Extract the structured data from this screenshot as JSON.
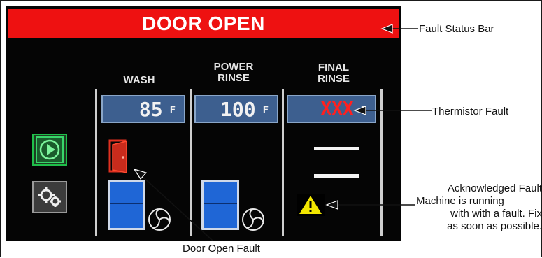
{
  "status_bar": {
    "text": "DOOR OPEN",
    "color": "#ee1111"
  },
  "columns": [
    {
      "header_line1": "",
      "header_line2": "WASH",
      "temp_value": "85",
      "temp_unit": "F",
      "fault": false
    },
    {
      "header_line1": "POWER",
      "header_line2": "RINSE",
      "temp_value": "100",
      "temp_unit": "F",
      "fault": false
    },
    {
      "header_line1": "FINAL",
      "header_line2": "RINSE",
      "temp_value": "XXX",
      "temp_unit": "F",
      "fault": true
    }
  ],
  "icons": {
    "start": "play-button-icon",
    "settings": "gears-icon",
    "door": "door-open-icon",
    "tank": "tank-icon",
    "fan": "fan-icon",
    "warning": "warning-triangle-icon"
  },
  "annotations": {
    "fault_status_bar": "Fault Status Bar",
    "thermistor_fault": "Thermistor Fault",
    "acknowledged_fault_lines": [
      "Acknowledged Fault",
      "Machine is running",
      "with with a fault. Fix",
      "as soon as possible."
    ],
    "door_open_fault": "Door Open Fault"
  },
  "colors": {
    "screen_bg": "#050505",
    "temp_box": "#3d5f8f",
    "fault_text": "#ff2020",
    "tank_blue": "#1f66d6",
    "play_green": "#1fbf4a",
    "warning_yellow": "#f2e600"
  }
}
